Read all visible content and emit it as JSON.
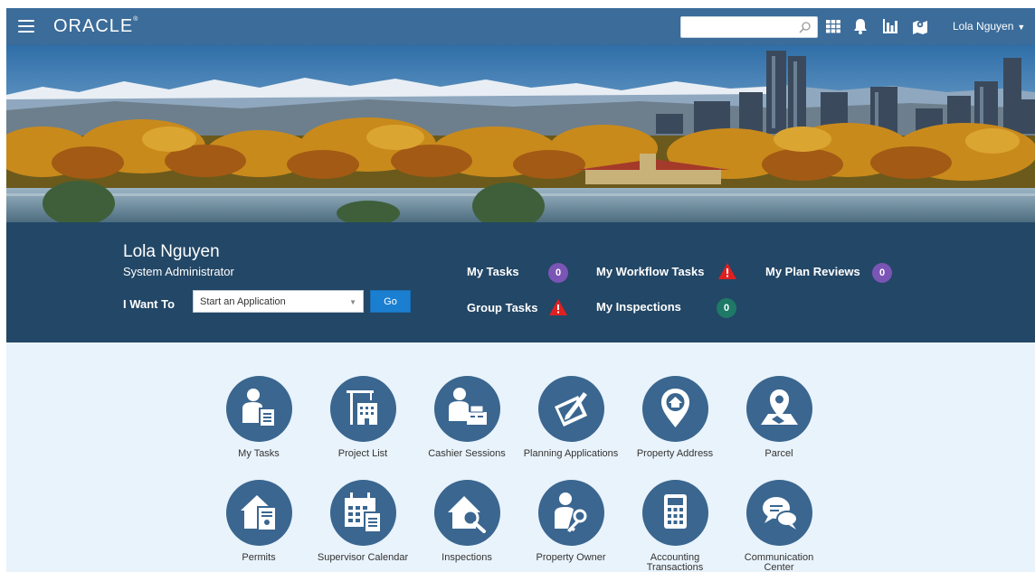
{
  "header": {
    "brand": "ORACLE",
    "brand_mark": "®",
    "search": {
      "value": "",
      "placeholder": ""
    },
    "icons": [
      "search-icon",
      "apps-grid-icon",
      "bell-icon",
      "bar-chart-icon",
      "map-pin-icon"
    ],
    "user_name": "Lola Nguyen",
    "user_caret": "▼"
  },
  "profile": {
    "name": "Lola Nguyen",
    "role": "System Administrator",
    "i_want_to_label": "I Want To",
    "select_value": "Start an Application",
    "go_label": "Go"
  },
  "tasks": {
    "my_tasks": {
      "label": "My Tasks",
      "count": "0"
    },
    "group_tasks": {
      "label": "Group Tasks",
      "status": "warning"
    },
    "my_workflow_tasks": {
      "label": "My Workflow Tasks",
      "status": "warning"
    },
    "my_inspections": {
      "label": "My Inspections",
      "count": "0"
    },
    "my_plan_reviews": {
      "label": "My Plan Reviews",
      "count": "0"
    }
  },
  "tiles": [
    {
      "label": "My Tasks",
      "icon": "user-document-icon"
    },
    {
      "label": "Project List",
      "icon": "building-crane-icon"
    },
    {
      "label": "Cashier Sessions",
      "icon": "cashier-icon"
    },
    {
      "label": "Planning Applications",
      "icon": "blueprint-pencil-icon"
    },
    {
      "label": "Property Address",
      "icon": "home-pin-icon"
    },
    {
      "label": "Parcel",
      "icon": "map-pin-icon"
    },
    {
      "label": "Permits",
      "icon": "house-document-icon"
    },
    {
      "label": "Supervisor Calendar",
      "icon": "calendar-icon"
    },
    {
      "label": "Inspections",
      "icon": "house-magnifier-icon"
    },
    {
      "label": "Property Owner",
      "icon": "user-key-icon"
    },
    {
      "label": "Accounting Transactions",
      "icon": "calculator-icon"
    },
    {
      "label": "Communication Center",
      "icon": "chat-bubbles-icon"
    }
  ],
  "colors": {
    "topbar": "#3b6c9a",
    "infoband": "#234766",
    "page_bg": "#e9f3fb",
    "tile": "#3a6690",
    "purple_badge": "#7a55b5",
    "teal_badge": "#1e7a66",
    "warning": "#e02020",
    "go_button": "#1b7fd1"
  }
}
